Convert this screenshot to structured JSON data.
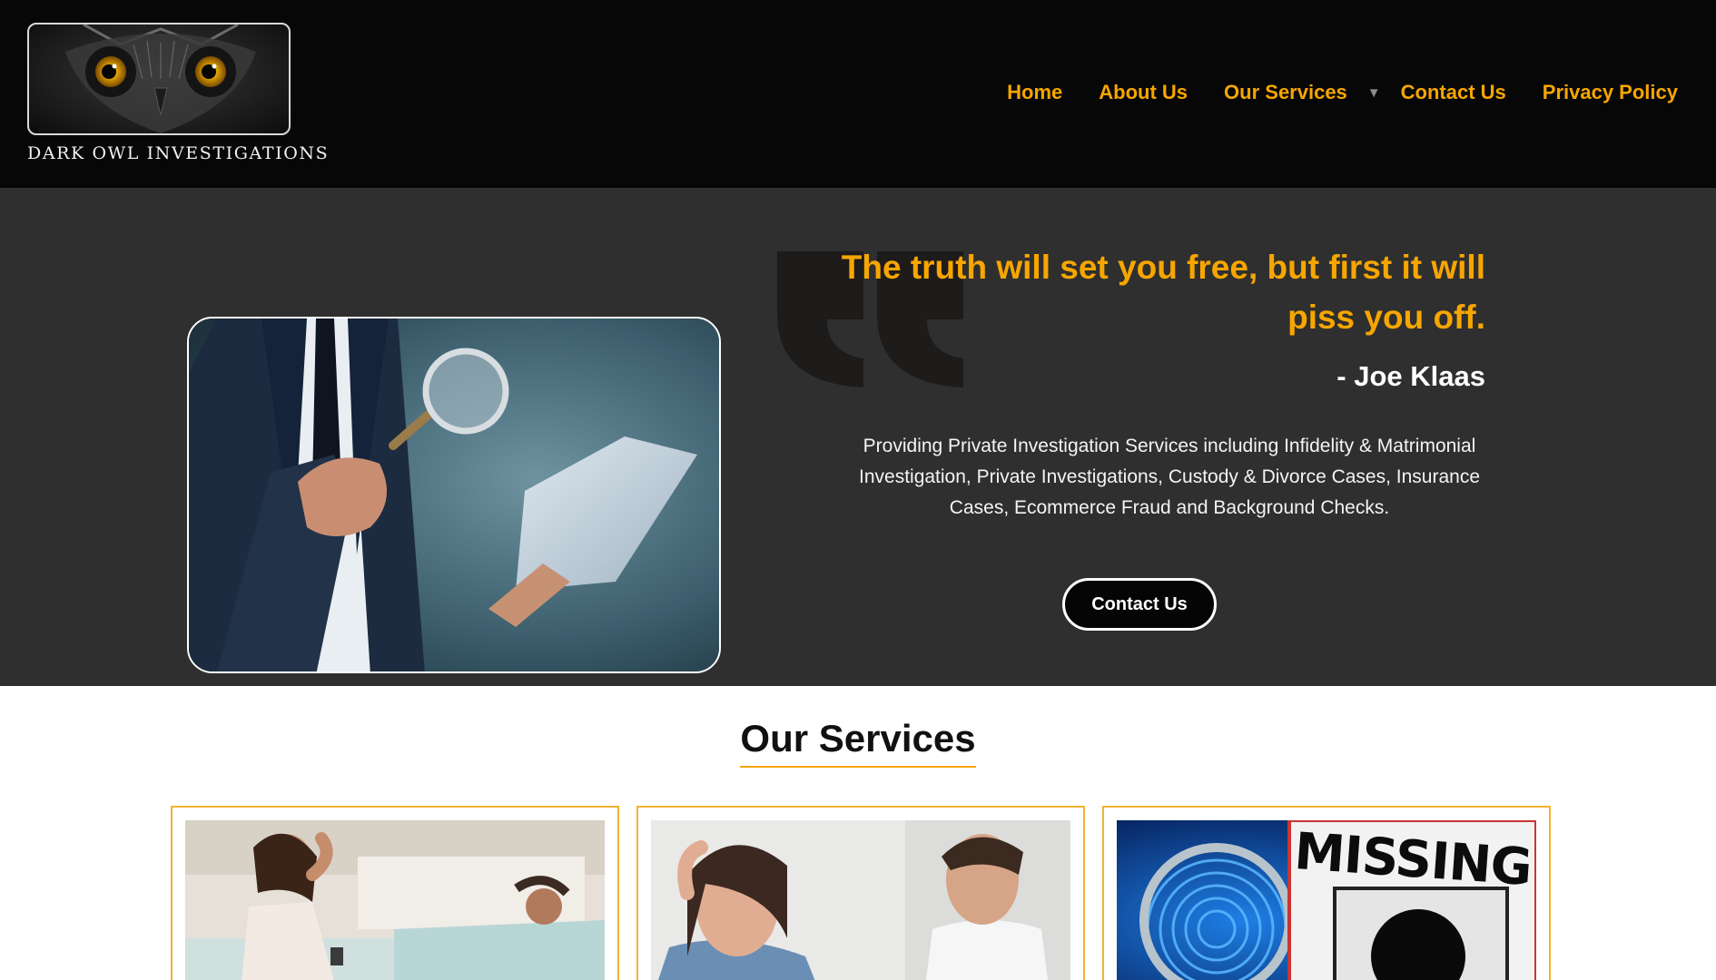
{
  "header": {
    "logo_text": "DARK OWL INVESTIGATIONS",
    "nav": [
      {
        "label": "Home"
      },
      {
        "label": "About Us"
      },
      {
        "label": "Our Services",
        "has_dropdown": true
      },
      {
        "label": "Contact Us"
      },
      {
        "label": "Privacy Policy"
      }
    ]
  },
  "hero": {
    "quote": "The truth will set you free, but first it will piss you off.",
    "author": "- Joe Klaas",
    "description": "Providing Private Investigation Services including Infidelity & Matrimonial Investigation, Private Investigations, Custody & Divorce Cases, Insurance Cases, Ecommerce Fraud and Background Checks.",
    "button_label": "Contact Us"
  },
  "services": {
    "title": "Our Services",
    "cards": [
      {
        "image": "infidelity-photo"
      },
      {
        "image": "divorce-photo"
      },
      {
        "image": "missing-persons-photo",
        "image_text": "MISSING"
      }
    ]
  },
  "colors": {
    "accent": "#f7a600",
    "header_bg": "#070707",
    "hero_bg": "#2f2f2f",
    "card_border": "#f2b233"
  }
}
